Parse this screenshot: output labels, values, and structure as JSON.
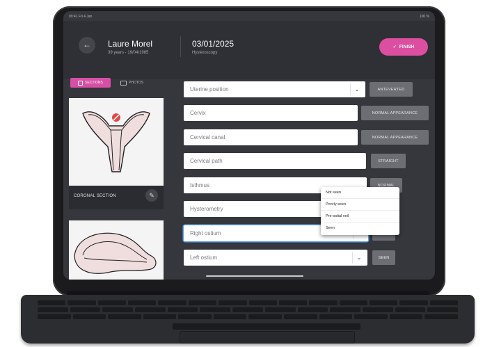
{
  "statusbar": {
    "time": "09:41 Fri 4 Jan",
    "battery": "100 %"
  },
  "header": {
    "back_icon": "arrow-left-icon",
    "patient_name": "Laure Morel",
    "patient_info": "39 years - 19/04/1985",
    "exam_date": "03/01/2025",
    "exam_type": "Hysteroscopy",
    "finish_label": "FINISH",
    "finish_color": "#dc4fa0"
  },
  "tabs": {
    "sections": "SECTIONS",
    "photos": "PHOTOS"
  },
  "sections": [
    {
      "title": "CORONAL SECTION"
    }
  ],
  "fields": [
    {
      "label": "Uterine position",
      "dropdown": true,
      "value": "ANTEVERTED"
    },
    {
      "label": "Cervix",
      "dropdown": false,
      "value": "NORMAL APPEARANCE"
    },
    {
      "label": "Cervical canal",
      "dropdown": false,
      "value": "NORMAL APPEARANCE"
    },
    {
      "label": "Cervical path",
      "dropdown": false,
      "value": "STRAIGHT"
    },
    {
      "label": "Isthmus",
      "dropdown": false,
      "value": "NORMAL"
    },
    {
      "label": "Hysterometry",
      "dropdown": false,
      "value": ""
    },
    {
      "label": "Right ostium",
      "dropdown": true,
      "value": "SEEN"
    },
    {
      "label": "Left ostium",
      "dropdown": true,
      "value": "SEEN"
    }
  ],
  "dropdown_options": [
    "Not seen",
    "Poorly seen",
    "Pre-ostial veil",
    "Seen"
  ],
  "colors": {
    "accent": "#dc4fa0",
    "focus": "#5aa3e6",
    "panel": "#35373d"
  }
}
